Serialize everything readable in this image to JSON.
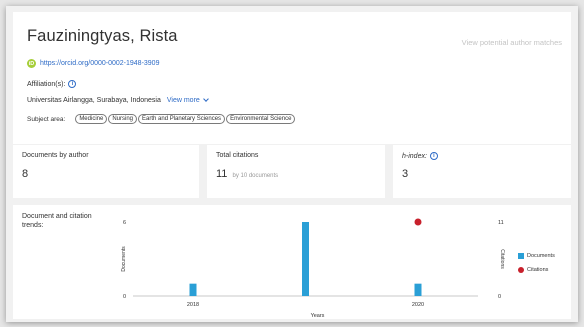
{
  "profile": {
    "name": "Fauziningtyas, Rista",
    "potential_matches": "View potential author matches",
    "orcid_badge": "iD",
    "orcid_url": "https://orcid.org/0000-0002-1948-3909",
    "affiliation_label": "Affiliation(s):",
    "affiliation": "Universitas Airlangga, Surabaya, Indonesia",
    "view_more": "View more",
    "subject_label": "Subject area:",
    "subjects": [
      "Medicine",
      "Nursing",
      "Earth and Planetary Sciences",
      "Environmental Science"
    ]
  },
  "metrics": {
    "documents_label": "Documents by author",
    "documents_value": "8",
    "citations_label": "Total citations",
    "citations_value": "11",
    "citations_sub": "by 10 documents",
    "hindex_label": "h-index:",
    "hindex_value": "3"
  },
  "chart_data": {
    "type": "bar",
    "title": "Document and citation trends:",
    "x": [
      2018,
      2019,
      2020
    ],
    "xticks": [
      "2018",
      "2020"
    ],
    "xlabel": "Years",
    "ylabel_left": "Documents",
    "ylabel_right": "Citations",
    "ylim_left": [
      0,
      6
    ],
    "ylim_right": [
      0,
      11
    ],
    "yticks_left": [
      "0",
      "6"
    ],
    "yticks_right": [
      "0",
      "11"
    ],
    "series": [
      {
        "name": "Documents",
        "kind": "bar",
        "axis": "left",
        "color": "#2a9fd6",
        "values": [
          1,
          6,
          1
        ]
      },
      {
        "name": "Citations",
        "kind": "point",
        "axis": "right",
        "color": "#c8202c",
        "values": [
          null,
          null,
          11
        ]
      }
    ],
    "legend_position": "right"
  }
}
